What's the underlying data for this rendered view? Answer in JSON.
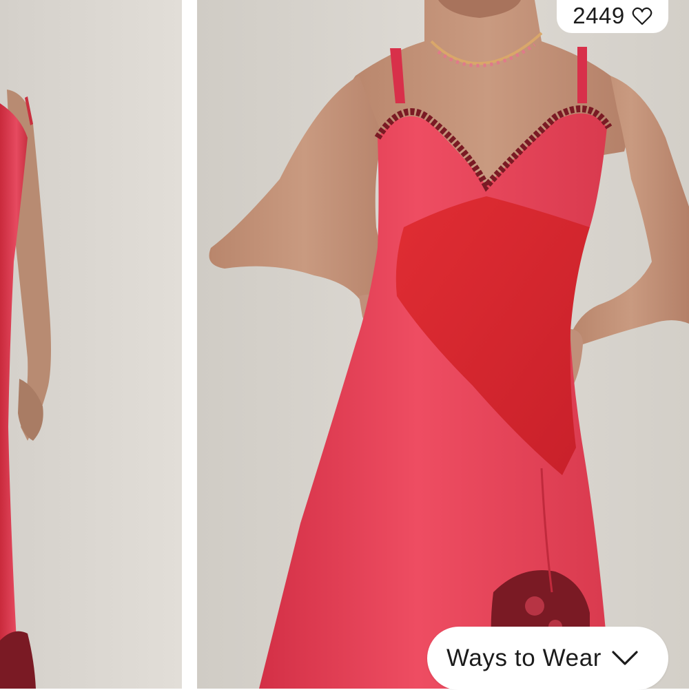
{
  "gallery": {
    "like_count": "2449",
    "like_icon": "heart-outline-icon",
    "ways_to_wear_label": "Ways to Wear",
    "ways_to_wear_icon": "chevron-down-icon"
  },
  "colors": {
    "pill_background": "#ffffff",
    "text": "#1b1b1b",
    "backdrop": "#d9d5cf",
    "dress_satin_pink": "#e8405a",
    "dress_chiffon_red": "#d8262c",
    "lace_trim": "#7a1a24"
  }
}
